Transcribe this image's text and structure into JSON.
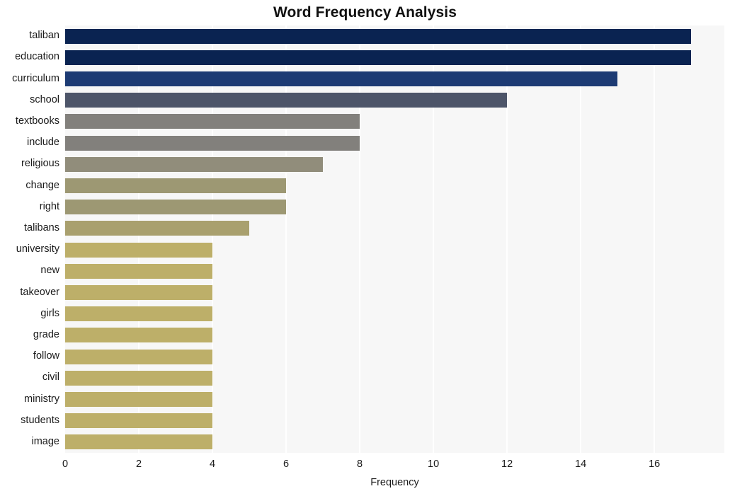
{
  "chart_data": {
    "type": "bar",
    "orientation": "horizontal",
    "title": "Word Frequency Analysis",
    "xlabel": "Frequency",
    "ylabel": "",
    "xlim": [
      0,
      17.9
    ],
    "xticks": [
      0,
      2,
      4,
      6,
      8,
      10,
      12,
      14,
      16
    ],
    "xtick_labels": [
      "0",
      "2",
      "4",
      "6",
      "8",
      "10",
      "12",
      "14",
      "16"
    ],
    "grid": "vertical-white-on-light-gray",
    "legend": "none",
    "categories": [
      "taliban",
      "education",
      "curriculum",
      "school",
      "textbooks",
      "include",
      "religious",
      "change",
      "right",
      "talibans",
      "university",
      "new",
      "takeover",
      "girls",
      "grade",
      "follow",
      "civil",
      "ministry",
      "students",
      "image"
    ],
    "values": [
      17,
      17,
      15,
      12,
      8,
      8,
      7,
      6,
      6,
      5,
      4,
      4,
      4,
      4,
      4,
      4,
      4,
      4,
      4,
      4
    ],
    "bar_colors": [
      "#0a2351",
      "#0a2351",
      "#1d3b74",
      "#4d5569",
      "#82807c",
      "#82807c",
      "#918d7b",
      "#9d9873",
      "#9d9873",
      "#a9a06e",
      "#bdaf69",
      "#bdaf69",
      "#bdaf69",
      "#bdaf69",
      "#bdaf69",
      "#bdaf69",
      "#bdaf69",
      "#bdaf69",
      "#bdaf69",
      "#bdaf69"
    ]
  },
  "style": {
    "plot_background": "#f7f7f7",
    "grid_color": "#ffffff",
    "figure_background": "#ffffff",
    "text_color": "#1a1a1a",
    "title_color": "#111111"
  }
}
